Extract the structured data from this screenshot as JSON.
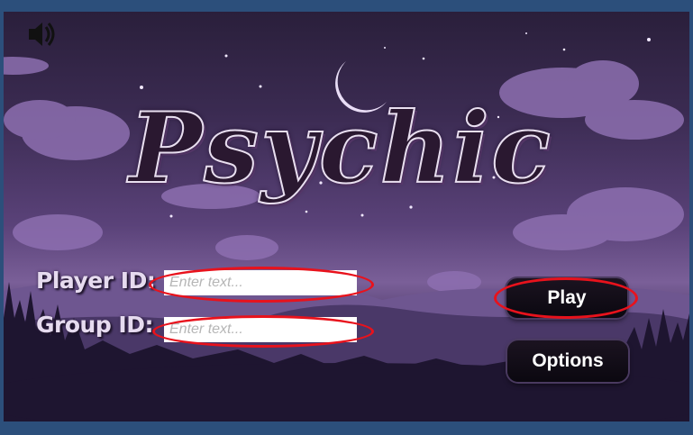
{
  "game": {
    "title": "Psychic"
  },
  "sound": {
    "icon": "speaker-muted-icon"
  },
  "form": {
    "player_label": "Player ID:",
    "player_placeholder": "Enter text...",
    "group_label": "Group ID:",
    "group_placeholder": "Enter text..."
  },
  "buttons": {
    "play_label": "Play",
    "options_label": "Options"
  },
  "colors": {
    "highlight_ring": "#e8121c",
    "frame": "#2c4f7b",
    "button_bg": "#0b0810"
  }
}
